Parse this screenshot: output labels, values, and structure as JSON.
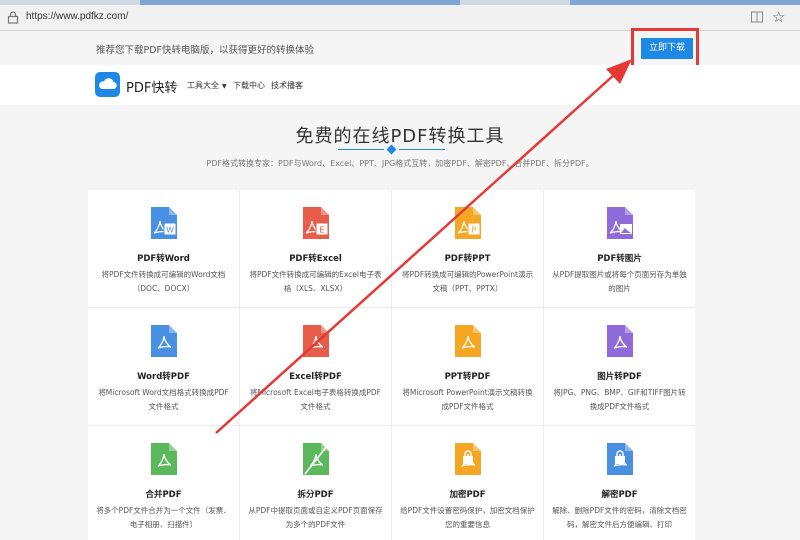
{
  "browser": {
    "url": "https://www.pdfkz.com/"
  },
  "promo": {
    "text": "推荐您下载PDF快转电脑版，以获得更好的转换体验",
    "download_label": "立即下载"
  },
  "nav": {
    "brand": "PDF快转",
    "items": [
      "工具大全",
      "下载中心",
      "技术播客"
    ]
  },
  "hero": {
    "title": "免费的在线PDF转换工具",
    "subtitle": "PDF格式转换专家：PDF与Word、Excel、PPT、JPG格式互转，加密PDF、解密PDF、合并PDF、拆分PDF。"
  },
  "colors": {
    "accent": "#1e88e5",
    "annotation": "#e53935"
  },
  "tools": [
    {
      "title": "PDF转Word",
      "desc": "将PDF文件转换成可编辑的Word文档（DOC、DOCX）",
      "icon": "word-doc-icon",
      "color": "#4a90e2"
    },
    {
      "title": "PDF转Excel",
      "desc": "将PDF文件转换成可编辑的Excel电子表格（XLS、XLSX）",
      "icon": "excel-doc-icon",
      "color": "#e85d4a"
    },
    {
      "title": "PDF转PPT",
      "desc": "将PDF转换成可编辑的PowerPoint演示文稿（PPT、PPTX）",
      "icon": "ppt-doc-icon",
      "color": "#f5a623"
    },
    {
      "title": "PDF转图片",
      "desc": "从PDF提取图片或将每个页面另存为单独的图片",
      "icon": "image-doc-icon",
      "color": "#8e6bd8"
    },
    {
      "title": "Word转PDF",
      "desc": "将Microsoft Word文档格式转换成PDF文件格式",
      "icon": "word-to-pdf-icon",
      "color": "#4a90e2"
    },
    {
      "title": "Excel转PDF",
      "desc": "将Microsoft Excel电子表格转换成PDF文件格式",
      "icon": "excel-to-pdf-icon",
      "color": "#e85d4a"
    },
    {
      "title": "PPT转PDF",
      "desc": "将Microsoft PowerPoint演示文稿转换成PDF文件格式",
      "icon": "ppt-to-pdf-icon",
      "color": "#f5a623"
    },
    {
      "title": "图片转PDF",
      "desc": "将JPG、PNG、BMP、GIF和TIFF图片转换成PDF文件格式",
      "icon": "image-to-pdf-icon",
      "color": "#8e6bd8"
    },
    {
      "title": "合并PDF",
      "desc": "将多个PDF文件合并为一个文件（发票、电子相册、扫描件）",
      "icon": "merge-pdf-icon",
      "color": "#5cb85c"
    },
    {
      "title": "拆分PDF",
      "desc": "从PDF中提取页面或自定义PDF页面保存为多个的PDF文件",
      "icon": "split-pdf-icon",
      "color": "#5cb85c"
    },
    {
      "title": "加密PDF",
      "desc": "给PDF文件设置密码保护，加密文档保护您的重要信息",
      "icon": "lock-pdf-icon",
      "color": "#f5a623"
    },
    {
      "title": "解密PDF",
      "desc": "解除、删除PDF文件的密码，清除文档密码，解密文件后方便编辑、打印",
      "icon": "unlock-pdf-icon",
      "color": "#4a90e2"
    }
  ]
}
